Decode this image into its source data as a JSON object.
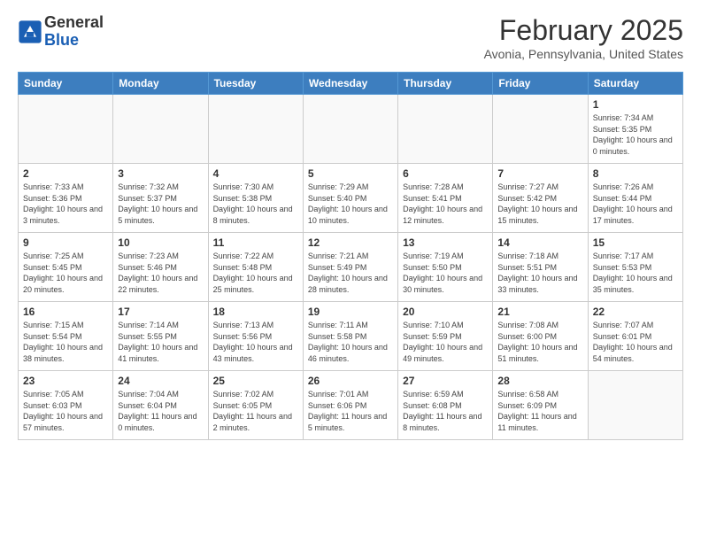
{
  "header": {
    "logo_line1": "General",
    "logo_line2": "Blue",
    "title": "February 2025",
    "location": "Avonia, Pennsylvania, United States"
  },
  "days_of_week": [
    "Sunday",
    "Monday",
    "Tuesday",
    "Wednesday",
    "Thursday",
    "Friday",
    "Saturday"
  ],
  "weeks": [
    [
      {
        "day": "",
        "info": ""
      },
      {
        "day": "",
        "info": ""
      },
      {
        "day": "",
        "info": ""
      },
      {
        "day": "",
        "info": ""
      },
      {
        "day": "",
        "info": ""
      },
      {
        "day": "",
        "info": ""
      },
      {
        "day": "1",
        "info": "Sunrise: 7:34 AM\nSunset: 5:35 PM\nDaylight: 10 hours and 0 minutes."
      }
    ],
    [
      {
        "day": "2",
        "info": "Sunrise: 7:33 AM\nSunset: 5:36 PM\nDaylight: 10 hours and 3 minutes."
      },
      {
        "day": "3",
        "info": "Sunrise: 7:32 AM\nSunset: 5:37 PM\nDaylight: 10 hours and 5 minutes."
      },
      {
        "day": "4",
        "info": "Sunrise: 7:30 AM\nSunset: 5:38 PM\nDaylight: 10 hours and 8 minutes."
      },
      {
        "day": "5",
        "info": "Sunrise: 7:29 AM\nSunset: 5:40 PM\nDaylight: 10 hours and 10 minutes."
      },
      {
        "day": "6",
        "info": "Sunrise: 7:28 AM\nSunset: 5:41 PM\nDaylight: 10 hours and 12 minutes."
      },
      {
        "day": "7",
        "info": "Sunrise: 7:27 AM\nSunset: 5:42 PM\nDaylight: 10 hours and 15 minutes."
      },
      {
        "day": "8",
        "info": "Sunrise: 7:26 AM\nSunset: 5:44 PM\nDaylight: 10 hours and 17 minutes."
      }
    ],
    [
      {
        "day": "9",
        "info": "Sunrise: 7:25 AM\nSunset: 5:45 PM\nDaylight: 10 hours and 20 minutes."
      },
      {
        "day": "10",
        "info": "Sunrise: 7:23 AM\nSunset: 5:46 PM\nDaylight: 10 hours and 22 minutes."
      },
      {
        "day": "11",
        "info": "Sunrise: 7:22 AM\nSunset: 5:48 PM\nDaylight: 10 hours and 25 minutes."
      },
      {
        "day": "12",
        "info": "Sunrise: 7:21 AM\nSunset: 5:49 PM\nDaylight: 10 hours and 28 minutes."
      },
      {
        "day": "13",
        "info": "Sunrise: 7:19 AM\nSunset: 5:50 PM\nDaylight: 10 hours and 30 minutes."
      },
      {
        "day": "14",
        "info": "Sunrise: 7:18 AM\nSunset: 5:51 PM\nDaylight: 10 hours and 33 minutes."
      },
      {
        "day": "15",
        "info": "Sunrise: 7:17 AM\nSunset: 5:53 PM\nDaylight: 10 hours and 35 minutes."
      }
    ],
    [
      {
        "day": "16",
        "info": "Sunrise: 7:15 AM\nSunset: 5:54 PM\nDaylight: 10 hours and 38 minutes."
      },
      {
        "day": "17",
        "info": "Sunrise: 7:14 AM\nSunset: 5:55 PM\nDaylight: 10 hours and 41 minutes."
      },
      {
        "day": "18",
        "info": "Sunrise: 7:13 AM\nSunset: 5:56 PM\nDaylight: 10 hours and 43 minutes."
      },
      {
        "day": "19",
        "info": "Sunrise: 7:11 AM\nSunset: 5:58 PM\nDaylight: 10 hours and 46 minutes."
      },
      {
        "day": "20",
        "info": "Sunrise: 7:10 AM\nSunset: 5:59 PM\nDaylight: 10 hours and 49 minutes."
      },
      {
        "day": "21",
        "info": "Sunrise: 7:08 AM\nSunset: 6:00 PM\nDaylight: 10 hours and 51 minutes."
      },
      {
        "day": "22",
        "info": "Sunrise: 7:07 AM\nSunset: 6:01 PM\nDaylight: 10 hours and 54 minutes."
      }
    ],
    [
      {
        "day": "23",
        "info": "Sunrise: 7:05 AM\nSunset: 6:03 PM\nDaylight: 10 hours and 57 minutes."
      },
      {
        "day": "24",
        "info": "Sunrise: 7:04 AM\nSunset: 6:04 PM\nDaylight: 11 hours and 0 minutes."
      },
      {
        "day": "25",
        "info": "Sunrise: 7:02 AM\nSunset: 6:05 PM\nDaylight: 11 hours and 2 minutes."
      },
      {
        "day": "26",
        "info": "Sunrise: 7:01 AM\nSunset: 6:06 PM\nDaylight: 11 hours and 5 minutes."
      },
      {
        "day": "27",
        "info": "Sunrise: 6:59 AM\nSunset: 6:08 PM\nDaylight: 11 hours and 8 minutes."
      },
      {
        "day": "28",
        "info": "Sunrise: 6:58 AM\nSunset: 6:09 PM\nDaylight: 11 hours and 11 minutes."
      },
      {
        "day": "",
        "info": ""
      }
    ]
  ]
}
